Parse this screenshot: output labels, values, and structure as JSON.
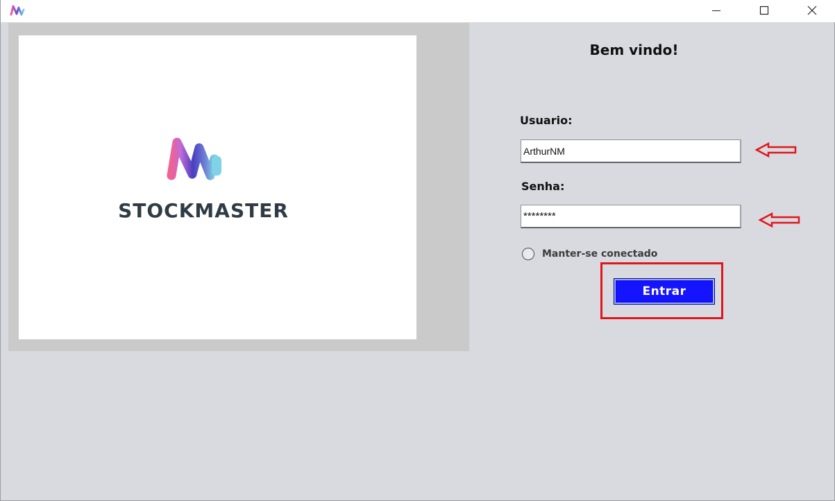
{
  "window": {
    "controls": {
      "minimize_icon": "minimize-icon",
      "maximize_icon": "maximize-icon",
      "close_icon": "close-icon"
    }
  },
  "logo": {
    "brand_name": "STOCKMASTER",
    "colors": {
      "mark_gradient_start": "#f06292",
      "mark_gradient_mid": "#6a4bd6",
      "mark_gradient_end": "#7fd3e6",
      "brand_text": "#2f3b45"
    }
  },
  "login": {
    "welcome": "Bem vindo!",
    "username_label": "Usuario:",
    "username_value": "ArthurNM",
    "password_label": "Senha:",
    "password_value": "********",
    "remember_label": "Manter-se conectado",
    "remember_checked": false,
    "submit_label": "Entrar"
  },
  "annotations": {
    "color": "#e0161b"
  }
}
